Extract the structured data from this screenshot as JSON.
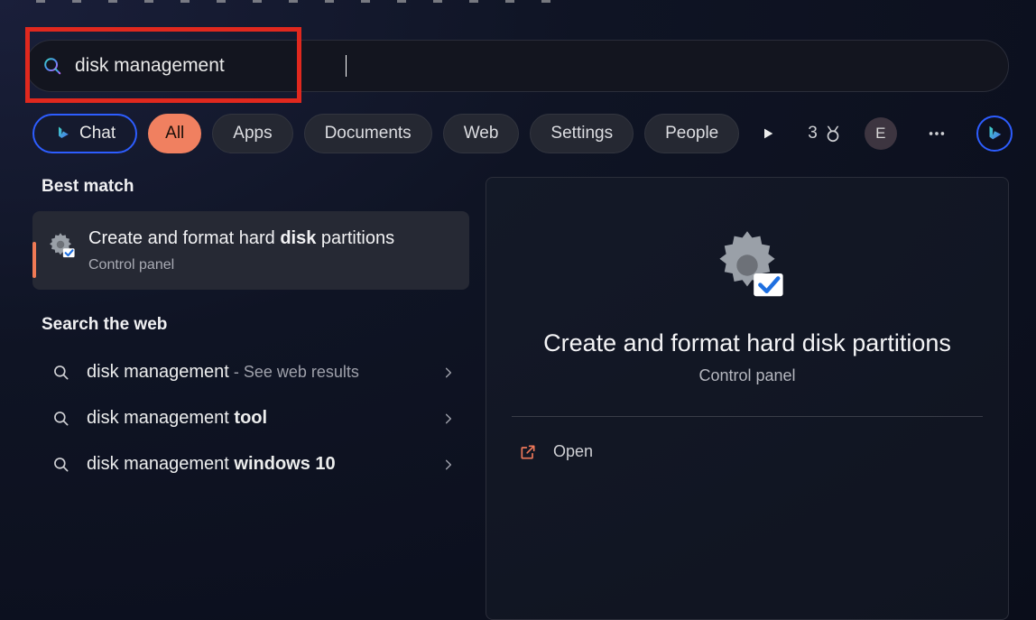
{
  "search": {
    "query": "disk management"
  },
  "filters": {
    "chat": "Chat",
    "all": "All",
    "apps": "Apps",
    "documents": "Documents",
    "web": "Web",
    "settings": "Settings",
    "people": "People"
  },
  "rewards": {
    "count": "3"
  },
  "avatar": {
    "initial": "E"
  },
  "sections": {
    "best_match": "Best match",
    "search_web": "Search the web"
  },
  "best": {
    "title_prefix": "Create and format hard ",
    "title_bold": "disk",
    "title_suffix": " partitions",
    "subtitle": "Control panel"
  },
  "web_results": [
    {
      "text": "disk management",
      "suffix": " - See web results",
      "bold": ""
    },
    {
      "text": "disk management ",
      "suffix": "",
      "bold": "tool"
    },
    {
      "text": "disk management ",
      "suffix": "",
      "bold": "windows 10"
    }
  ],
  "preview": {
    "title": "Create and format hard disk partitions",
    "subtitle": "Control panel",
    "open": "Open"
  }
}
